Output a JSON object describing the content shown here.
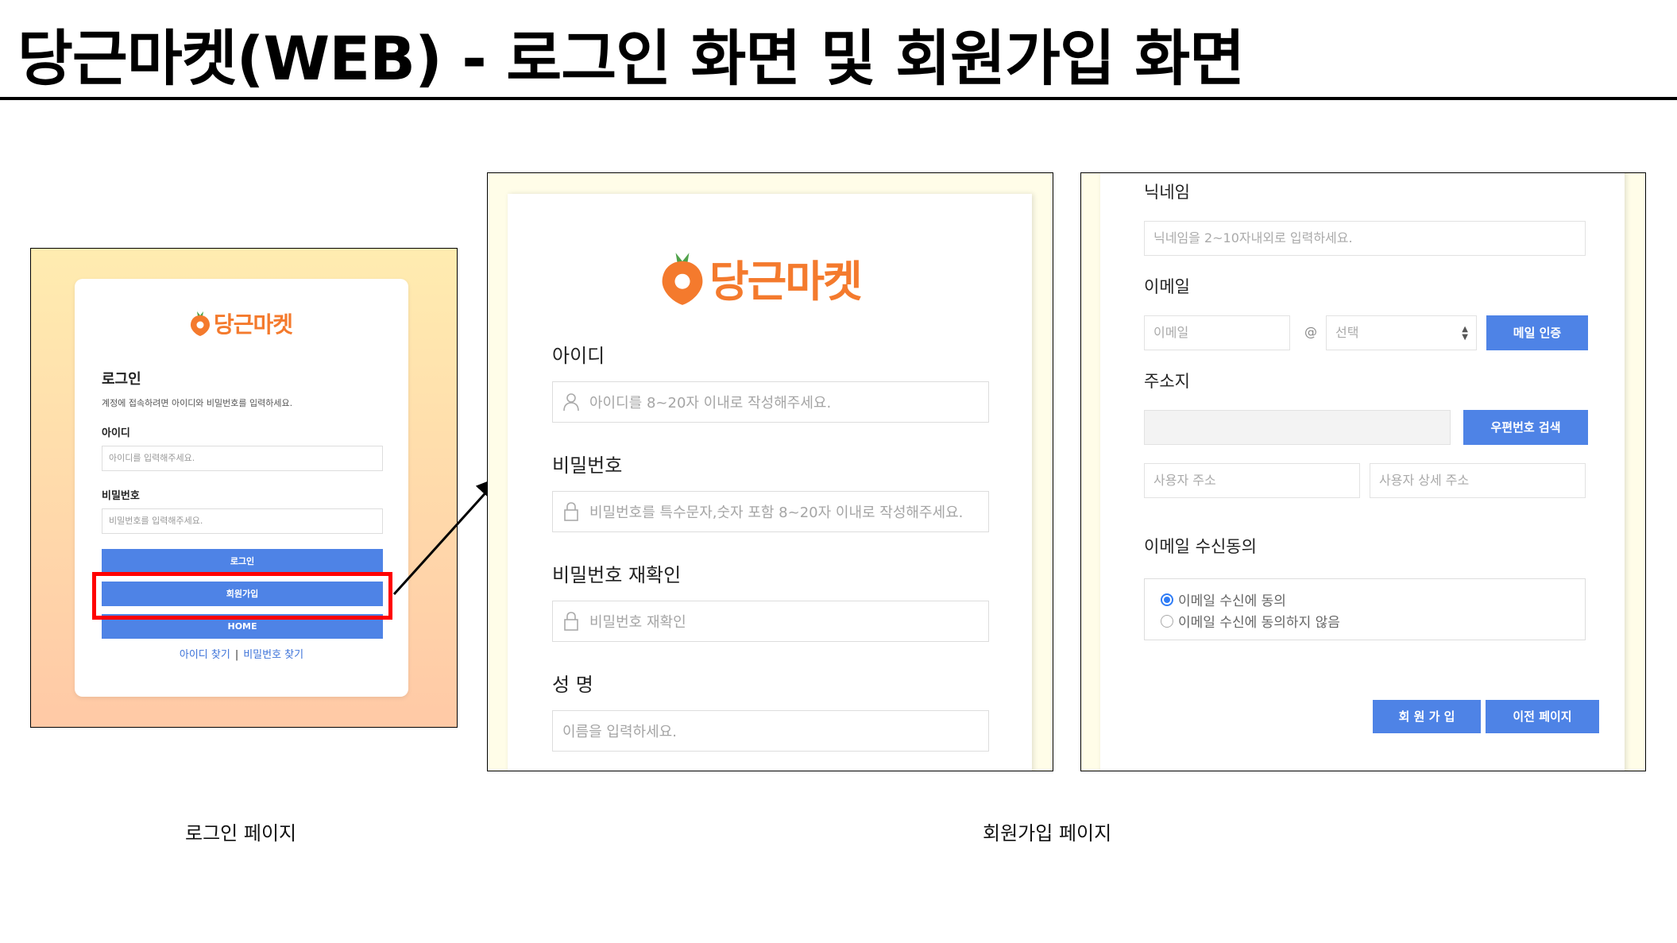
{
  "title": "당근마켓(WEB) - 로그인 화면 및 회원가입 화면",
  "colors": {
    "brand": "#f47a2d",
    "button": "#4e83e6",
    "highlight": "#ff0000",
    "link": "#3d73d9"
  },
  "login_page": {
    "brand": "당근마켓",
    "heading": "로그인",
    "description": "계정에 접속하려면 아이디와 비밀번호를 입력하세요.",
    "id_label": "아이디",
    "id_placeholder": "아이디를 입력해주세요.",
    "pw_label": "비밀번호",
    "pw_placeholder": "비밀번호를 입력해주세요.",
    "login_button": "로그인",
    "signup_button": "회원가입",
    "home_button": "HOME",
    "find_id": "아이디 찾기",
    "separator": "|",
    "find_pw": "비밀번호 찾기"
  },
  "signup_page1": {
    "brand": "당근마켓",
    "id_label": "아이디",
    "id_placeholder": "아이디를 8~20자 이내로 작성해주세요.",
    "pw_label": "비밀번호",
    "pw_placeholder": "비밀번호를 특수문자,숫자 포함 8~20자 이내로 작성해주세요.",
    "pw_confirm_label": "비밀번호 재확인",
    "pw_confirm_placeholder": "비밀번호 재확인",
    "name_label": "성 명",
    "name_placeholder": "이름을 입력하세요."
  },
  "signup_page2": {
    "nickname_label": "닉네임",
    "nickname_placeholder": "닉네임을 2~10자내외로 입력하세요.",
    "email_label": "이메일",
    "email_placeholder": "이메일",
    "at": "@",
    "domain_select": "선택",
    "email_verify_button": "메일 인증",
    "address_label": "주소지",
    "zipcode_button": "우편번호 검색",
    "address_placeholder": "사용자 주소",
    "address_detail_placeholder": "사용자 상세 주소",
    "consent_label": "이메일 수신동의",
    "consent_agree": "이메일 수신에 동의",
    "consent_disagree": "이메일 수신에 동의하지 않음",
    "submit_button": "회 원 가 입",
    "prev_button": "이전 페이지"
  },
  "captions": {
    "login": "로그인 페이지",
    "signup": "회원가입 페이지"
  }
}
